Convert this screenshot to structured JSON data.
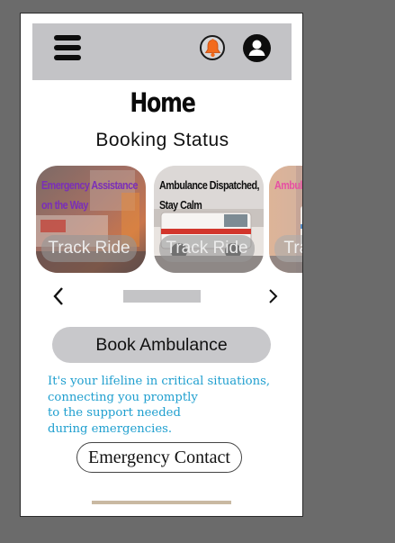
{
  "header": {
    "menu_icon": "hamburger-menu-icon",
    "notification_icon": "bell-icon",
    "profile_icon": "user-profile-icon",
    "colors": {
      "bar": "#c3c3c6",
      "bell": "#f26b1d"
    }
  },
  "page": {
    "title": "Home",
    "subtitle": "Booking Status"
  },
  "carousel": {
    "cards": [
      {
        "caption_lines": [
          "Emergency Assistance",
          "on the Way"
        ],
        "button": "Track Ride",
        "caption_color": "#7a2fb8"
      },
      {
        "caption_lines": [
          "Ambulance Dispatched,",
          "Stay Calm"
        ],
        "button": "Track Ride",
        "caption_color": "#0f0f0f"
      },
      {
        "caption_lines": [
          "Ambulance Coming"
        ],
        "button": "Track Ride",
        "caption_color": "#e0208a"
      }
    ],
    "prev_icon": "chevron-left-icon",
    "next_icon": "chevron-right-icon"
  },
  "actions": {
    "book_label": "Book Ambulance",
    "emergency_label": "Emergency Contact"
  },
  "tagline": {
    "lines": [
      "It's your lifeline in critical situations,",
      "connecting you promptly",
      "to the support needed",
      "during emergencies."
    ],
    "color": "#1f9fcf"
  }
}
